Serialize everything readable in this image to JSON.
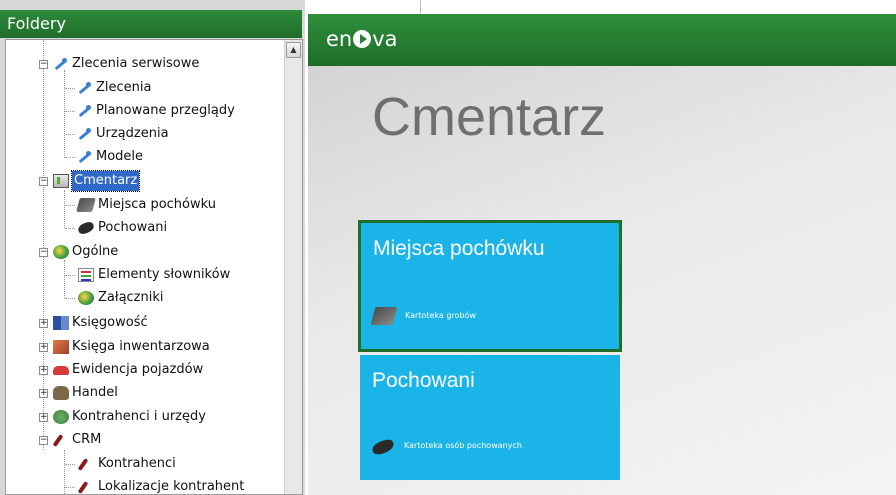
{
  "folders_panel": {
    "title": "Foldery",
    "tree": [
      {
        "label": "Zlecenia serwisowe",
        "icon": "wrench-icon",
        "expander": "−"
      },
      {
        "label": "Zlecenia",
        "icon": "wrench-icon"
      },
      {
        "label": "Planowane przeglądy",
        "icon": "wrench-icon"
      },
      {
        "label": "Urządzenia",
        "icon": "wrench-icon"
      },
      {
        "label": "Modele",
        "icon": "wrench-icon"
      },
      {
        "label": "Cmentarz",
        "icon": "cemetery-icon",
        "expander": "−",
        "selected": true
      },
      {
        "label": "Miejsca pochówku",
        "icon": "grave-icon"
      },
      {
        "label": "Pochowani",
        "icon": "coffin-icon"
      },
      {
        "label": "Ogólne",
        "icon": "globe-icon",
        "expander": "−"
      },
      {
        "label": "Elementy słowników",
        "icon": "dictionary-icon"
      },
      {
        "label": "Załączniki",
        "icon": "globe-icon"
      },
      {
        "label": "Księgowość",
        "icon": "books-icon",
        "expander": "+"
      },
      {
        "label": "Księga inwentarzowa",
        "icon": "box-icon",
        "expander": "+"
      },
      {
        "label": "Ewidencja pojazdów",
        "icon": "car-icon",
        "expander": "+"
      },
      {
        "label": "Handel",
        "icon": "hand-icon",
        "expander": "+"
      },
      {
        "label": "Kontrahenci i urzędy",
        "icon": "partner-icon",
        "expander": "+"
      },
      {
        "label": "CRM",
        "icon": "crm-icon",
        "expander": "−"
      },
      {
        "label": "Kontrahenci",
        "icon": "crm-icon"
      },
      {
        "label": "Lokalizacje kontrahent",
        "icon": "crm-icon"
      }
    ]
  },
  "brand": {
    "logo_left": "en",
    "logo_right": "va"
  },
  "main": {
    "title": "Cmentarz",
    "tiles": [
      {
        "title": "Miejsca pochówku",
        "subtitle": "Kartoteka grobów",
        "icon": "grave-icon"
      },
      {
        "title": "Pochowani",
        "subtitle": "Kartoteka osób pochowanych",
        "icon": "coffin-icon"
      }
    ]
  },
  "colors": {
    "brand_green": "#1f6e2b",
    "tile_blue": "#1ab4e8",
    "selection": "#3169c6"
  }
}
